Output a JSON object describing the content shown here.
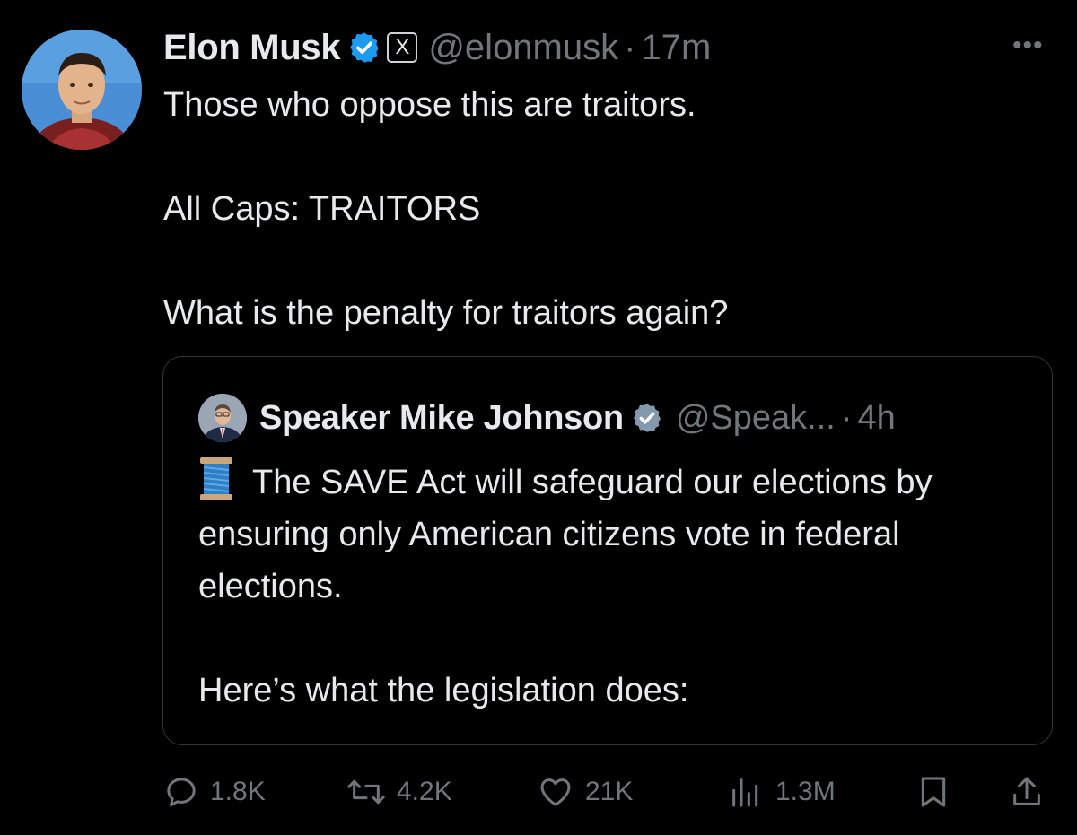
{
  "tweet": {
    "author_name": "Elon Musk",
    "handle": "@elonmusk",
    "separator": "·",
    "time": "17m",
    "more_label": "•••",
    "affiliate_badge": "X",
    "avatar_icon": "user-avatar-icon",
    "verified_icon": "verified-badge-icon",
    "verified_color": "#1d9bf0",
    "lines": [
      "Those who oppose this are traitors.",
      "All Caps: TRAITORS",
      "What is the penalty for traitors again?"
    ]
  },
  "quote": {
    "author_name": "Speaker Mike Johnson",
    "handle": "@Speak...",
    "separator": "·",
    "time": "4h",
    "verified_icon": "verified-badge-gray-icon",
    "verified_color": "#829aab",
    "emoji_icon": "thread-spool-icon",
    "paragraph_1": "The SAVE Act will safeguard our elections by ensuring only American citizens vote in federal elections.",
    "paragraph_2": "Here’s what the legislation does:"
  },
  "actions": {
    "replies": "1.8K",
    "reposts": "4.2K",
    "likes": "21K",
    "views": "1.3M"
  },
  "colors": {
    "background": "#000000",
    "text": "#e7e9ea",
    "secondary": "#71767b",
    "border": "#333639"
  }
}
